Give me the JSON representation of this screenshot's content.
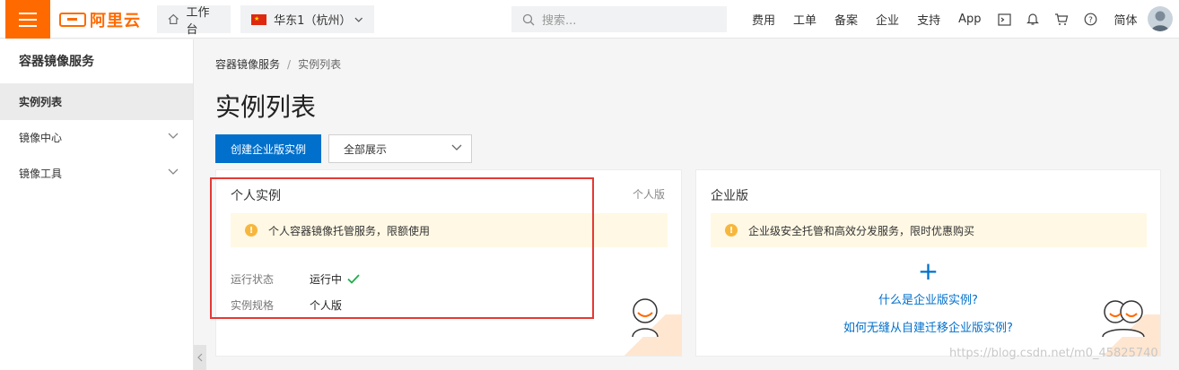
{
  "topbar": {
    "logo_text": "阿里云",
    "workbench_label": "工作台",
    "region_label": "华东1（杭州）",
    "search_placeholder": "搜索...",
    "links": [
      "费用",
      "工单",
      "备案",
      "企业",
      "支持",
      "App"
    ],
    "lang_label": "简体",
    "brand_color": "#ff6a00"
  },
  "sidebar": {
    "title": "容器镜像服务",
    "items": [
      {
        "label": "实例列表",
        "active": true
      },
      {
        "label": "镜像中心",
        "expandable": true
      },
      {
        "label": "镜像工具",
        "expandable": true
      }
    ]
  },
  "main": {
    "breadcrumb": [
      "容器镜像服务",
      "实例列表"
    ],
    "breadcrumb_sep": "/",
    "page_title": "实例列表",
    "create_button": "创建企业版实例",
    "filter_select": "全部展示",
    "accent_color": "#0070cc"
  },
  "personal_card": {
    "title": "个人实例",
    "tag": "个人版",
    "notice": "个人容器镜像托管服务，限额使用",
    "status_label": "运行状态",
    "status_value": "运行中",
    "spec_label": "实例规格",
    "spec_value": "个人版"
  },
  "enterprise_card": {
    "title": "企业版",
    "notice": "企业级安全托管和高效分发服务，限时优惠购买",
    "link1": "什么是企业版实例?",
    "link2": "如何无缝从自建迁移企业版实例?"
  },
  "watermark": "https://blog.csdn.net/m0_45825740"
}
